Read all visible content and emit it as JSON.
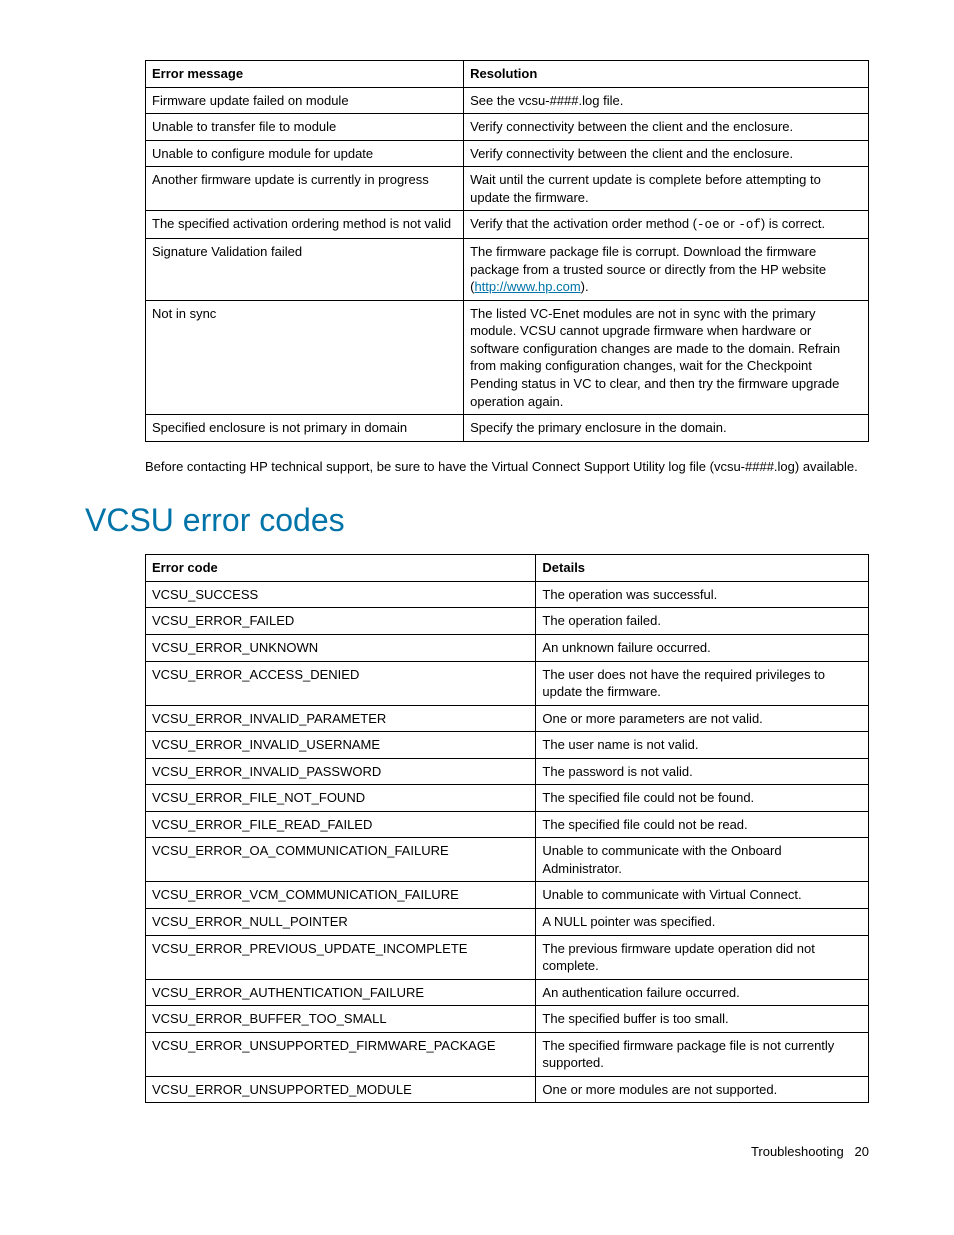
{
  "table1": {
    "headers": [
      "Error message",
      "Resolution"
    ],
    "rows": [
      {
        "c0": "Firmware update failed on module",
        "c1": "See the vcsu-####.log file."
      },
      {
        "c0": "Unable to transfer file to module",
        "c1": "Verify connectivity between the client and the enclosure."
      },
      {
        "c0": "Unable to configure module for update",
        "c1": "Verify connectivity between the client and the enclosure."
      },
      {
        "c0": "Another firmware update is currently in progress",
        "c1": "Wait until the current update is complete before attempting to update the firmware."
      },
      {
        "c0": "The specified activation ordering method is not valid",
        "c1_pre": "Verify that the activation order method (",
        "c1_code1": "-oe",
        "c1_mid": " or ",
        "c1_code2": "-of",
        "c1_post": ") is correct."
      },
      {
        "c0": "Signature Validation failed",
        "c1_pre": "The firmware package file is corrupt. Download the firmware package from a trusted source or directly from the HP website (",
        "c1_link": "http://www.hp.com",
        "c1_post": ")."
      },
      {
        "c0": "Not in sync",
        "c1": "The listed VC-Enet modules are not in sync with the primary module. VCSU cannot upgrade firmware when hardware or software configuration changes are made to the domain. Refrain from making configuration changes, wait for the Checkpoint Pending status in VC to clear, and then try the firmware upgrade operation again."
      },
      {
        "c0": "Specified enclosure is not primary in domain",
        "c1": "Specify the primary enclosure in the domain."
      }
    ]
  },
  "paragraph1": "Before contacting HP technical support, be sure to have the Virtual Connect Support Utility log file (vcsu-####.log) available.",
  "heading1": "VCSU error codes",
  "table2": {
    "headers": [
      "Error code",
      "Details"
    ],
    "rows": [
      {
        "c0": "VCSU_SUCCESS",
        "c1": "The operation was successful."
      },
      {
        "c0": "VCSU_ERROR_FAILED",
        "c1": "The operation failed."
      },
      {
        "c0": "VCSU_ERROR_UNKNOWN",
        "c1": "An unknown failure occurred."
      },
      {
        "c0": "VCSU_ERROR_ACCESS_DENIED",
        "c1": "The user does not have the required privileges to update the firmware."
      },
      {
        "c0": "VCSU_ERROR_INVALID_PARAMETER",
        "c1": "One or more parameters are not valid."
      },
      {
        "c0": "VCSU_ERROR_INVALID_USERNAME",
        "c1": "The user name is not valid."
      },
      {
        "c0": "VCSU_ERROR_INVALID_PASSWORD",
        "c1": "The password is not valid."
      },
      {
        "c0": "VCSU_ERROR_FILE_NOT_FOUND",
        "c1": "The specified file could not be found."
      },
      {
        "c0": "VCSU_ERROR_FILE_READ_FAILED",
        "c1": "The specified file could not be read."
      },
      {
        "c0": "VCSU_ERROR_OA_COMMUNICATION_FAILURE",
        "c1": "Unable to communicate with the Onboard Administrator."
      },
      {
        "c0": "VCSU_ERROR_VCM_COMMUNICATION_FAILURE",
        "c1": "Unable to communicate with Virtual Connect."
      },
      {
        "c0": "VCSU_ERROR_NULL_POINTER",
        "c1": "A NULL pointer was specified."
      },
      {
        "c0": "VCSU_ERROR_PREVIOUS_UPDATE_INCOMPLETE",
        "c1": "The previous firmware update operation did not complete."
      },
      {
        "c0": "VCSU_ERROR_AUTHENTICATION_FAILURE",
        "c1": "An authentication failure occurred."
      },
      {
        "c0": "VCSU_ERROR_BUFFER_TOO_SMALL",
        "c1": "The specified buffer is too small."
      },
      {
        "c0": "VCSU_ERROR_UNSUPPORTED_FIRMWARE_PACKAGE",
        "c1": "The specified firmware package file is not currently supported."
      },
      {
        "c0": "VCSU_ERROR_UNSUPPORTED_MODULE",
        "c1": "One or more modules are not supported."
      }
    ]
  },
  "footer": {
    "section": "Troubleshooting",
    "page": "20"
  }
}
